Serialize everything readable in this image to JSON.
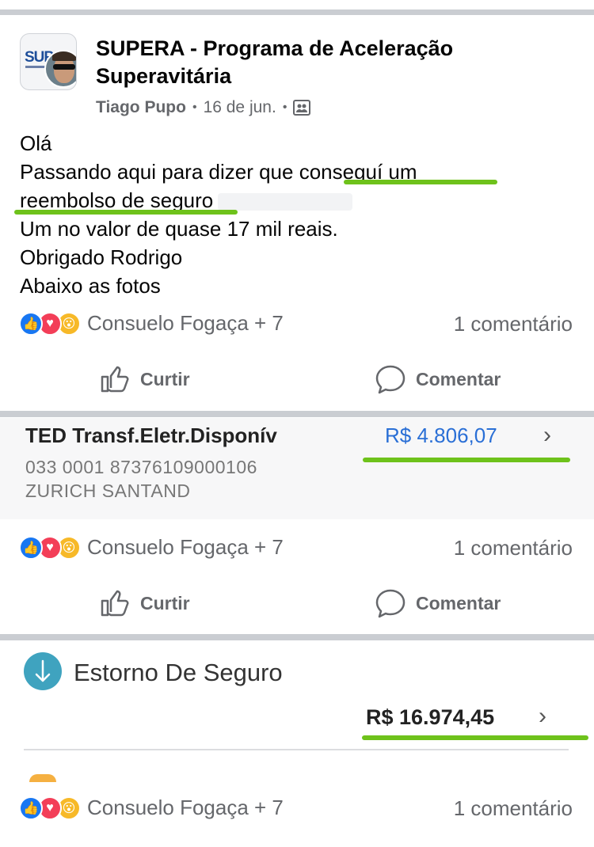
{
  "post": {
    "group_title": "SUPERA - Programa de Aceleração Superavitária",
    "author": "Tiago Pupo",
    "date": "16 de jun.",
    "avatar_text": "SUP",
    "lines": [
      "Olá",
      "Passando aqui para dizer que conseguí um",
      "reembolso de seguro",
      "Um no valor de quase 17 mil reais.",
      "Obrigado Rodrigo",
      "Abaixo as fotos"
    ]
  },
  "reactions": {
    "names": "Consuelo Fogaça + 7",
    "comments": "1 comentário",
    "icons": [
      "like-icon",
      "love-icon",
      "wow-icon"
    ]
  },
  "actions": {
    "like": "Curtir",
    "comment": "Comentar"
  },
  "bank_ted": {
    "title": "TED Transf.Eletr.Disponív",
    "amount": "R$ 4.806,07",
    "line1": "033 0001 87376109000106",
    "line2": "ZURICH SANTAND"
  },
  "bank_refund": {
    "title": "Estorno De Seguro",
    "amount": "R$ 16.974,45"
  },
  "colors": {
    "highlight": "#6ec21b",
    "link_blue": "#2a6fd6",
    "separator": "#cacdd2"
  }
}
